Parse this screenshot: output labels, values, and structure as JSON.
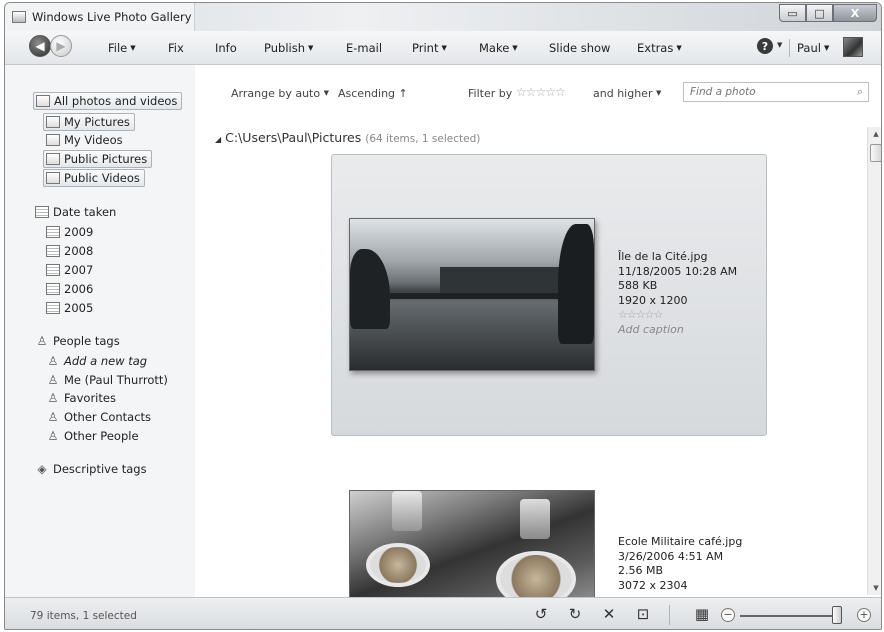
{
  "window": {
    "title": "Windows Live Photo Gallery",
    "min_glyph": "▭",
    "max_glyph": "□",
    "close_glyph": "X"
  },
  "toolbar": {
    "back_glyph": "◀",
    "forward_glyph": "▶",
    "menus": [
      {
        "label": "File",
        "caret": "▼"
      },
      {
        "label": "Fix",
        "caret": ""
      },
      {
        "label": "Info",
        "caret": ""
      },
      {
        "label": "Publish",
        "caret": "▼"
      },
      {
        "label": "E-mail",
        "caret": ""
      },
      {
        "label": "Print",
        "caret": "▼"
      },
      {
        "label": "Make",
        "caret": "▼"
      },
      {
        "label": "Slide show",
        "caret": ""
      },
      {
        "label": "Extras",
        "caret": "▼"
      }
    ],
    "help_glyph": "?",
    "user": {
      "label": "Paul",
      "caret": "▼"
    }
  },
  "sidebar": {
    "all_label": "All photos and videos",
    "folders": [
      "My Pictures",
      "My Videos",
      "Public Pictures",
      "Public Videos"
    ],
    "date_taken_label": "Date taken",
    "years": [
      "2009",
      "2008",
      "2007",
      "2006",
      "2005"
    ],
    "people_tags_label": "People tags",
    "people": [
      "Add a new tag",
      "Me (Paul Thurrott)",
      "Favorites",
      "Other Contacts",
      "Other People"
    ],
    "descriptive_tags_label": "Descriptive tags"
  },
  "filterbar": {
    "arrange": "Arrange by auto",
    "arrange_caret": "▼",
    "order": "Ascending",
    "order_arrow": "↑",
    "filter_by": "Filter by",
    "stars": "☆☆☆☆☆",
    "and_higher": "and higher",
    "higher_caret": "▼",
    "search_placeholder": "Find a photo",
    "search_glyph": "⌕"
  },
  "gallery": {
    "folder_triangle": "◢",
    "folder_path": "C:\\Users\\Paul\\Pictures",
    "folder_meta": "(64 items, 1 selected)",
    "photos": [
      {
        "name": "Île de la Cité.jpg",
        "date": "11/18/2005 10:28 AM",
        "size": "588 KB",
        "dimensions": "1920 x 1200",
        "rating": "☆☆☆☆☆",
        "caption": "Add caption"
      },
      {
        "name": "Ecole Militaire café.jpg",
        "date": "3/26/2006 4:51 AM",
        "size": "2.56 MB",
        "dimensions": "3072 x 2304"
      }
    ]
  },
  "scrollbar": {
    "up_glyph": "▲",
    "down_glyph": "▼"
  },
  "statusbar": {
    "text": "79 items, 1 selected",
    "rotate_left_glyph": "↺",
    "rotate_right_glyph": "↻",
    "delete_glyph": "✕",
    "slideshow_glyph": "⊡",
    "thumbnail_view_glyph": "▦",
    "zoom_out_glyph": "−",
    "zoom_in_glyph": "+",
    "zoom_level": 0.97
  }
}
